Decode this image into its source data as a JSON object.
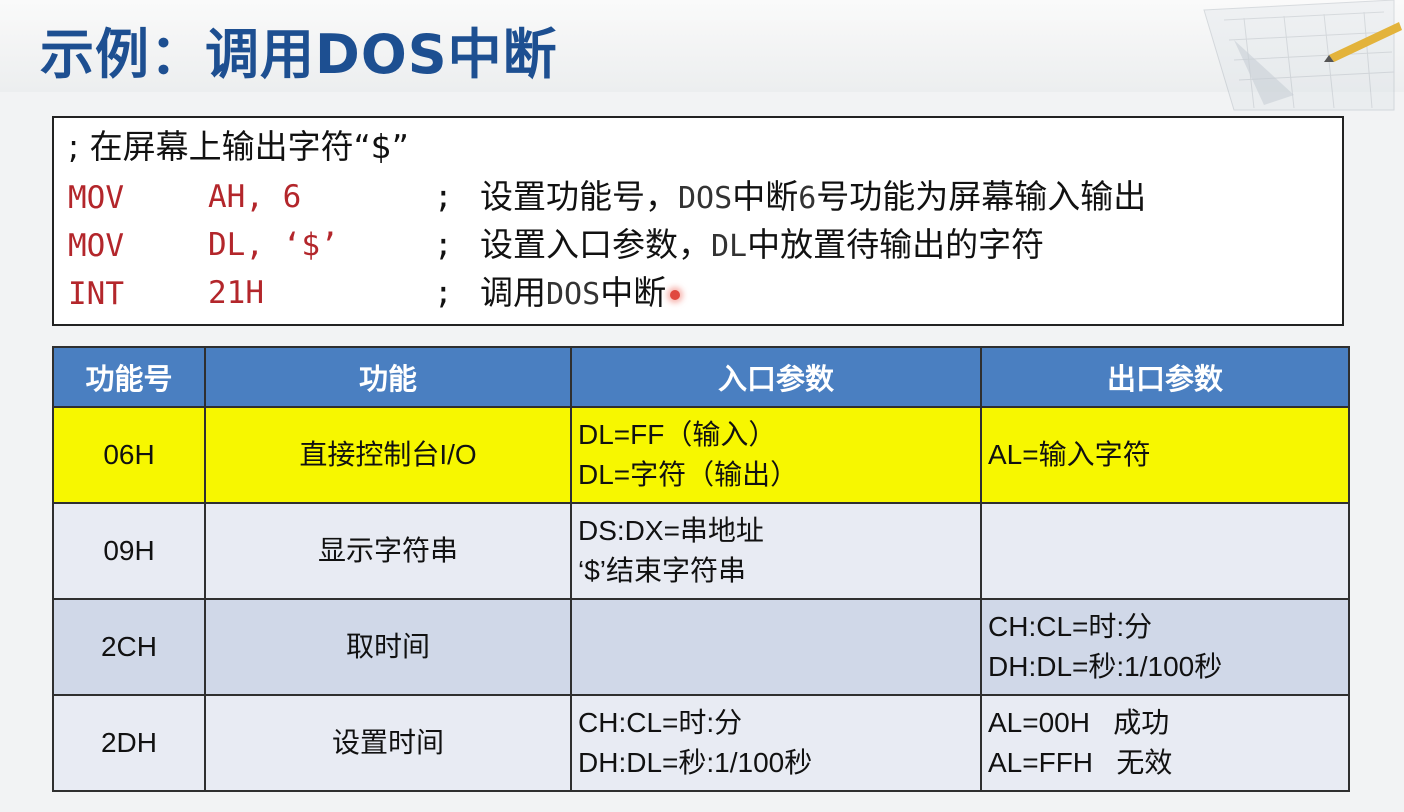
{
  "title": "示例：调用DOS中断",
  "code": {
    "comment_line": "; 在屏幕上输出字符“$”",
    "lines": [
      {
        "op": "MOV",
        "args": "AH, 6",
        "semi": ";",
        "comment_cn1": "设置功能号，",
        "comment_mono": "DOS",
        "comment_cn2": "中断",
        "comment_mono2": "6",
        "comment_cn3": "号功能为屏幕输入输出"
      },
      {
        "op": "MOV",
        "args": "DL, ‘$’",
        "semi": ";",
        "comment_cn1": "设置入口参数，",
        "comment_mono": "DL",
        "comment_cn2": "中放置待输出的字符",
        "comment_mono2": "",
        "comment_cn3": ""
      },
      {
        "op": "INT",
        "args": "21H",
        "semi": ";",
        "comment_cn1": "调用",
        "comment_mono": "DOS",
        "comment_cn2": "中断",
        "comment_mono2": "",
        "comment_cn3": ""
      }
    ]
  },
  "table": {
    "headers": [
      "功能号",
      "功能",
      "入口参数",
      "出口参数"
    ],
    "rows": [
      {
        "code": "06H",
        "func": "直接控制台I/O",
        "entry": [
          "DL=FF（输入）",
          "DL=字符（输出）"
        ],
        "exit": [
          "AL=输入字符",
          ""
        ]
      },
      {
        "code": "09H",
        "func": "显示字符串",
        "entry": [
          "DS:DX=串地址",
          "‘$’结束字符串"
        ],
        "exit": [
          "",
          ""
        ]
      },
      {
        "code": "2CH",
        "func": "取时间",
        "entry": [
          "",
          ""
        ],
        "exit": [
          "CH:CL=时:分",
          "DH:DL=秒:1/100秒"
        ]
      },
      {
        "code": "2DH",
        "func": "设置时间",
        "entry": [
          "CH:CL=时:分",
          "DH:DL=秒:1/100秒"
        ],
        "exit": [
          "AL=00H   成功",
          "AL=FFH   无效"
        ]
      }
    ]
  },
  "colors": {
    "title": "#1d4f91",
    "header_bg": "#4a7fc1",
    "highlight_row": "#f7f700",
    "code_op": "#b3262b"
  }
}
